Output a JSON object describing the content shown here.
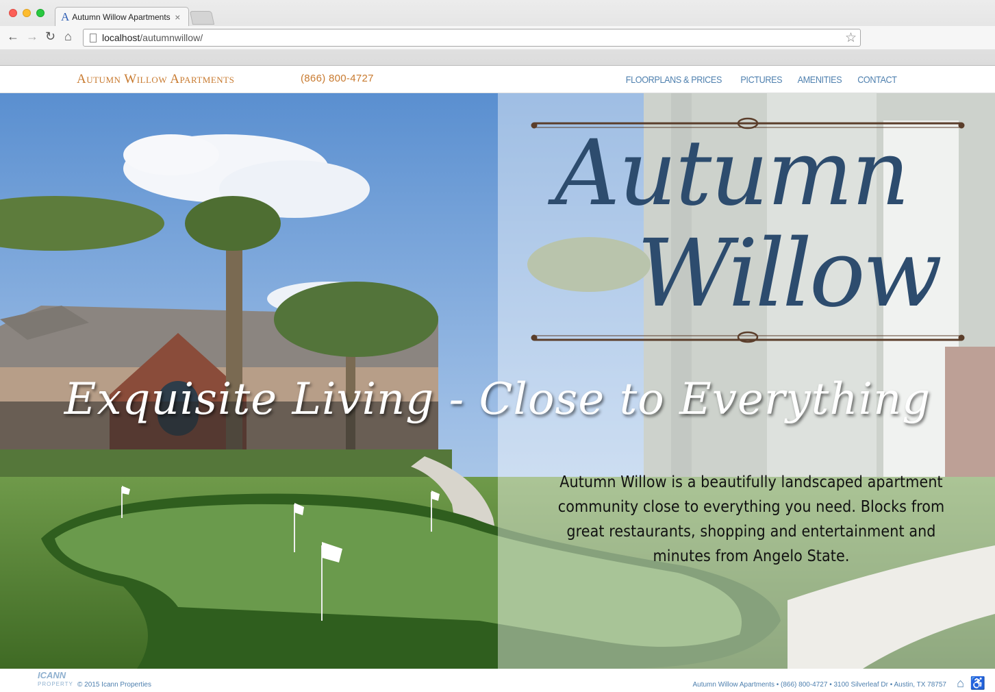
{
  "browser": {
    "tab_title": "Autumn Willow Apartments",
    "tab_favicon": "A",
    "url_host": "localhost",
    "url_path": "/autumnwillow/"
  },
  "header": {
    "brand": "Autumn Willow Apartments",
    "phone": "(866) 800-4727",
    "nav": [
      "FLOORPLANS & PRICES",
      "PICTURES",
      "AMENITIES",
      "CONTACT"
    ],
    "accent_color": "#c87a2f",
    "nav_color": "#4d7fae"
  },
  "hero": {
    "logo_line1": "Autumn",
    "logo_line2": "Willow",
    "tagline": "Exquisite Living - Close to Everything",
    "blurb": "Autumn Willow is a beautifully landscaped apartment community close to everything you need. Blocks from great restaurants, shopping and entertainment and minutes from Angelo State.",
    "logo_color": "#2d4c6e"
  },
  "footer": {
    "logo_line1": "ICANN",
    "logo_line2": "PROPERTY",
    "copyright": "© 2015 Icann Properties",
    "address": "Autumn Willow Apartments • (866) 800-4727 • 3100 Silverleaf Dr • Austin, TX 78757",
    "icons": [
      "equal-housing-icon",
      "accessibility-icon"
    ]
  }
}
